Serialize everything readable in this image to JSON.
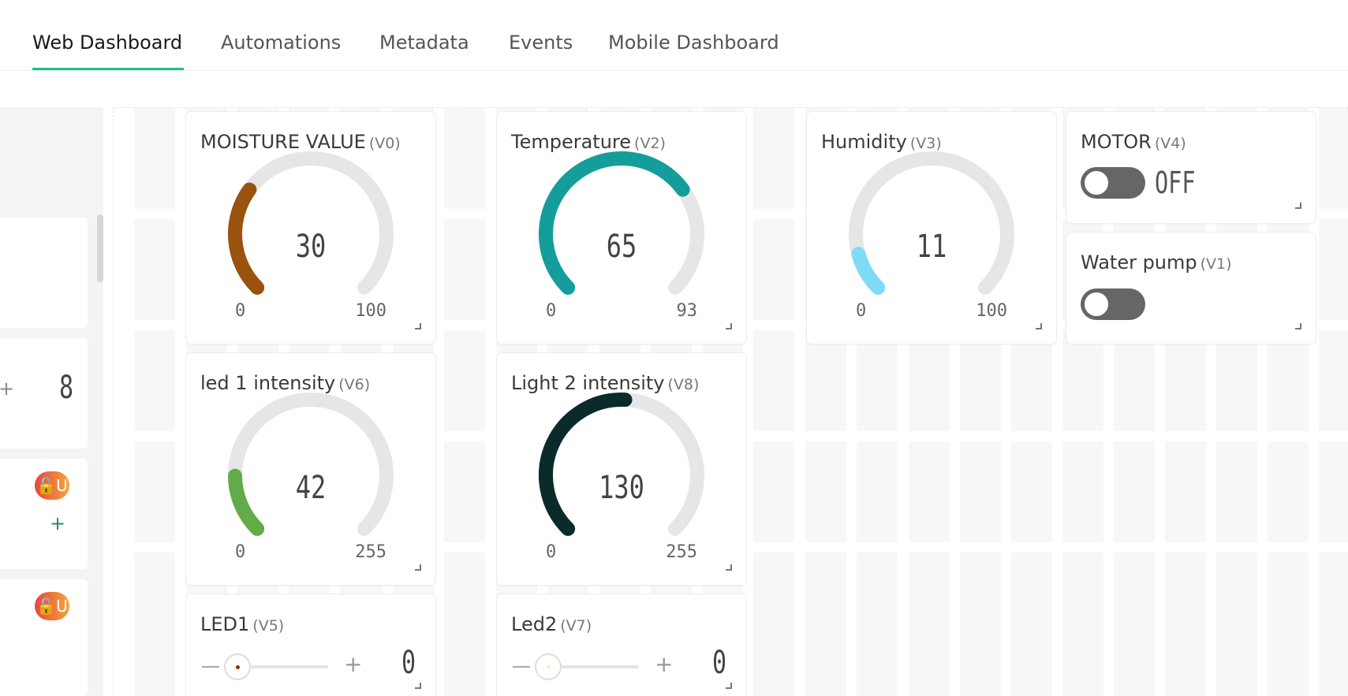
{
  "tabs": [
    {
      "label": "Web Dashboard",
      "active": true
    },
    {
      "label": "Automations",
      "active": false
    },
    {
      "label": "Metadata",
      "active": false
    },
    {
      "label": "Events",
      "active": false
    },
    {
      "label": "Mobile Dashboard",
      "active": false
    }
  ],
  "left_panel": {
    "stepper_value": "8",
    "stepper_plus": "+",
    "badge_text": "U",
    "add_plus": "+"
  },
  "gauges": [
    {
      "title": "MOISTURE VALUE",
      "pin": "(V0)",
      "value": "30",
      "min": "0",
      "max": "100",
      "color": "#9a520f",
      "fraction": 0.3
    },
    {
      "title": "Temperature",
      "pin": "(V2)",
      "value": "65",
      "min": "0",
      "max": "93",
      "color": "#139e9c",
      "fraction": 0.7
    },
    {
      "title": "Humidity",
      "pin": "(V3)",
      "value": "11",
      "min": "0",
      "max": "100",
      "color": "#7fdaf5",
      "fraction": 0.11
    },
    {
      "title": "led 1 intensity",
      "pin": "(V6)",
      "value": "42",
      "min": "0",
      "max": "255",
      "color": "#62ab48",
      "fraction": 0.165
    },
    {
      "title": "Light 2 intensity",
      "pin": "(V8)",
      "value": "130",
      "min": "0",
      "max": "255",
      "color": "#0b2b2b",
      "fraction": 0.51
    }
  ],
  "switches": [
    {
      "title": "MOTOR",
      "pin": "(V4)",
      "state_label": "OFF",
      "on": false
    },
    {
      "title": "Water pump",
      "pin": "(V1)",
      "state_label": "",
      "on": false
    }
  ],
  "sliders": [
    {
      "title": "LED1",
      "pin": "(V5)",
      "value": "0",
      "dot_color": "#8b2a0a",
      "plus": "+"
    },
    {
      "title": "Led2",
      "pin": "(V7)",
      "value": "0",
      "dot_color": "#f2f0c8",
      "plus": "+"
    }
  ]
}
